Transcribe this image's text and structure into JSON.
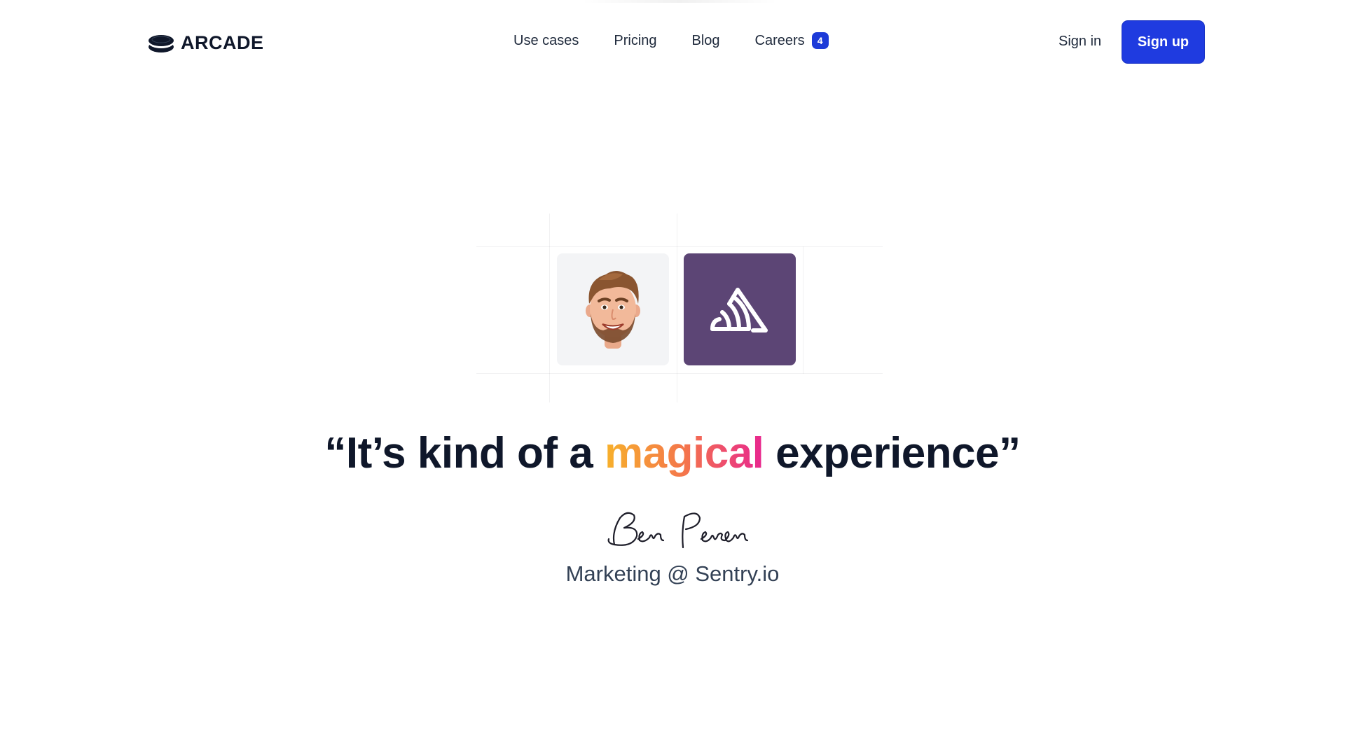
{
  "brand": {
    "name": "ARCADE"
  },
  "nav": {
    "items": [
      {
        "label": "Use cases"
      },
      {
        "label": "Pricing"
      },
      {
        "label": "Blog"
      },
      {
        "label": "Careers",
        "badge": "4"
      }
    ]
  },
  "auth": {
    "signin_label": "Sign in",
    "signup_label": "Sign up"
  },
  "testimonial": {
    "quote_open": "“It’s kind of a ",
    "quote_highlight": "magical",
    "quote_close": " experience”",
    "signature": "Ben Peven",
    "role": "Marketing @ Sentry.io"
  },
  "colors": {
    "accent": "#1f3be0",
    "sentry_tile": "#5c4575",
    "highlight_gradient": [
      "#f7b12b",
      "#f4764b",
      "#e8268f"
    ]
  },
  "icons": {
    "avatar": "memoji-avatar",
    "company": "sentry-logo-icon",
    "brand": "arcade-logo-icon"
  }
}
